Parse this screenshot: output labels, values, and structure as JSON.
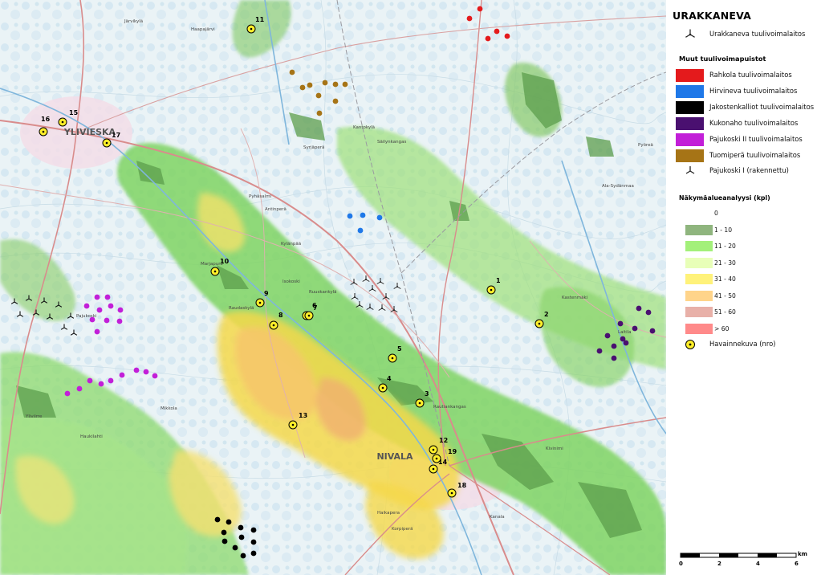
{
  "legend": {
    "title": "URAKKANEVA",
    "main_turbine_label": "Urakkaneva tuulivoimalaitos",
    "others_heading": "Muut tuulivoimapuistot",
    "parks": [
      {
        "label": "Rahkola tuulivoimalaitos",
        "color": "#e41a1c"
      },
      {
        "label": "Hirvineva tuulivoimalaitos",
        "color": "#1f78e8"
      },
      {
        "label": "Jakostenkalliot tuulivoimalaitos",
        "color": "#000000"
      },
      {
        "label": "Kukonaho tuulivoimalaitos",
        "color": "#4a1070"
      },
      {
        "label": "Pajukoski II tuulivoimalaitos",
        "color": "#c21fd8"
      },
      {
        "label": "Tuomiperä tuulivoimalaitos",
        "color": "#a67416"
      }
    ],
    "built_label": "Pajukoski I  (rakennettu)",
    "visibility_heading": "Näkymäalueanalyysi (kpl)",
    "visibility_classes": [
      {
        "label": "0",
        "color": "#ffffff"
      },
      {
        "label": "1 - 10",
        "color": "#8fb57e"
      },
      {
        "label": "11 - 20",
        "color": "#a3f07a"
      },
      {
        "label": "21 - 30",
        "color": "#e8ffb8"
      },
      {
        "label": "31 - 40",
        "color": "#fff27a"
      },
      {
        "label": "41 - 50",
        "color": "#ffd48a"
      },
      {
        "label": "51 - 60",
        "color": "#e8b0a8"
      },
      {
        "label": "> 60",
        "color": "#ff8a8a"
      }
    ],
    "photo_label": "Havainnekuva (nro)",
    "scale": {
      "labels": [
        "0",
        "2",
        "4",
        "6"
      ],
      "unit": "km"
    }
  },
  "map": {
    "towns": [
      "YLIVIESKA",
      "NIVALA"
    ],
    "places": [
      "Järvikylä",
      "Haapajärvi",
      "Kantokylä",
      "Säilynkangas",
      "Syrjäperä",
      "Ala-Sydänmaa",
      "Pyhäsalmi",
      "Pyöreä",
      "Antinperä",
      "Kylänpää",
      "Marjapuro",
      "Isokoski",
      "Raudaskylä",
      "Ruuskankylä",
      "Kastenmäki",
      "Laitila",
      "Rautiankangas",
      "Haikapera",
      "Korpiperä",
      "Pajukoski",
      "Kanala",
      "Yliviirre",
      "Haukilahti",
      "Mikkola",
      "Kivinimi"
    ],
    "photos": [
      "1",
      "2",
      "3",
      "4",
      "5",
      "6",
      "7",
      "8",
      "9",
      "10",
      "11",
      "12",
      "13",
      "14",
      "15",
      "16",
      "17",
      "18",
      "19"
    ]
  }
}
